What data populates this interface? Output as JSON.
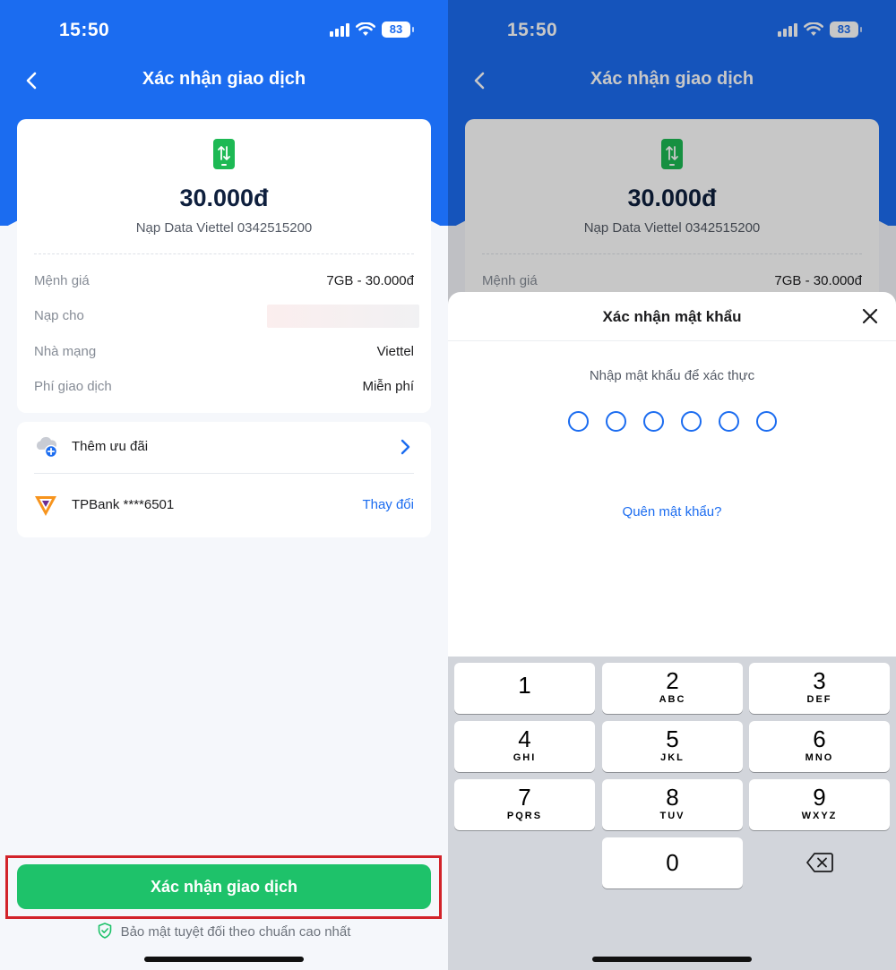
{
  "status": {
    "time": "15:50",
    "battery": "83"
  },
  "left": {
    "nav_title": "Xác nhận giao dịch",
    "amount": "30.000đ",
    "subtitle": "Nạp Data Viettel 0342515200",
    "rows": [
      {
        "label": "Mệnh giá",
        "value": "7GB - 30.000đ"
      },
      {
        "label": "Nạp cho",
        "value": ""
      },
      {
        "label": "Nhà mạng",
        "value": "Viettel"
      },
      {
        "label": "Phí giao dịch",
        "value": "Miễn phí"
      }
    ],
    "promo_label": "Thêm ưu đãi",
    "bank_label": "TPBank ****6501",
    "change_label": "Thay đổi",
    "confirm_label": "Xác nhận giao dịch",
    "security_note": "Bảo mật tuyệt đối theo chuẩn cao nhất"
  },
  "right": {
    "nav_title": "Xác nhận giao dịch",
    "amount": "30.000đ",
    "subtitle": "Nạp Data Viettel 0342515200",
    "row_label": "Mệnh giá",
    "row_value": "7GB - 30.000đ",
    "sheet_title": "Xác nhận mật khẩu",
    "prompt": "Nhập mật khẩu để xác thực",
    "pin_length": 6,
    "forgot": "Quên mật khẩu?",
    "keys": [
      {
        "digit": "1",
        "letters": ""
      },
      {
        "digit": "2",
        "letters": "ABC"
      },
      {
        "digit": "3",
        "letters": "DEF"
      },
      {
        "digit": "4",
        "letters": "GHI"
      },
      {
        "digit": "5",
        "letters": "JKL"
      },
      {
        "digit": "6",
        "letters": "MNO"
      },
      {
        "digit": "7",
        "letters": "PQRS"
      },
      {
        "digit": "8",
        "letters": "TUV"
      },
      {
        "digit": "9",
        "letters": "WXYZ"
      },
      {
        "digit": "0",
        "letters": ""
      }
    ]
  },
  "colors": {
    "brand_blue": "#1b6cf0",
    "confirm_green": "#1ec26a",
    "highlight_red": "#d2232a",
    "viettel_green": "#1db954"
  },
  "icons": [
    "back-chevron-icon",
    "phone-data-icon",
    "promo-cloud-icon",
    "chevron-right-icon",
    "tpbank-logo-icon",
    "shield-check-icon",
    "close-icon",
    "backspace-icon",
    "signal-icon",
    "wifi-icon",
    "battery-icon"
  ]
}
